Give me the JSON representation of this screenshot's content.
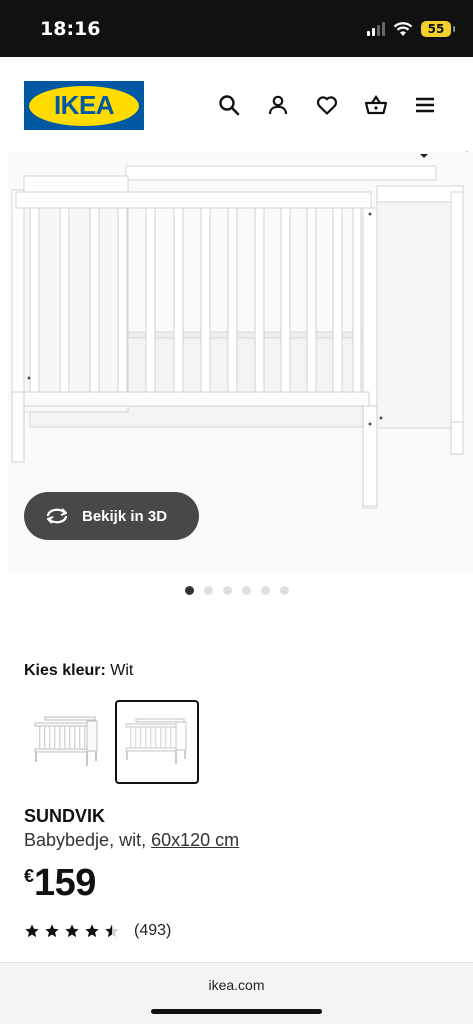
{
  "status_bar": {
    "time": "18:16",
    "battery": "55"
  },
  "header": {
    "logo_text": "IKEA"
  },
  "icons": [
    "search-icon",
    "user-icon",
    "heart-icon",
    "basket-icon",
    "menu-icon",
    "rotate-3d-icon",
    "star-icon"
  ],
  "gallery": {
    "view_3d_label": "Bekijk in 3D",
    "image_count": 6,
    "active_index": 0
  },
  "color_picker": {
    "label": "Kies kleur:",
    "selected_value": "Wit",
    "option_count": 2,
    "selected_option": 2
  },
  "product": {
    "name": "SUNDVIK",
    "description": "Babybedje, wit,",
    "size": "60x120 cm",
    "currency": "€",
    "price": "159",
    "rating": 4.5,
    "review_count": "(493)"
  },
  "browser": {
    "domain": "ikea.com"
  },
  "colors": {
    "ikea_blue": "#0058a3",
    "ikea_yellow": "#ffdb00",
    "button_dark": "#484848"
  }
}
